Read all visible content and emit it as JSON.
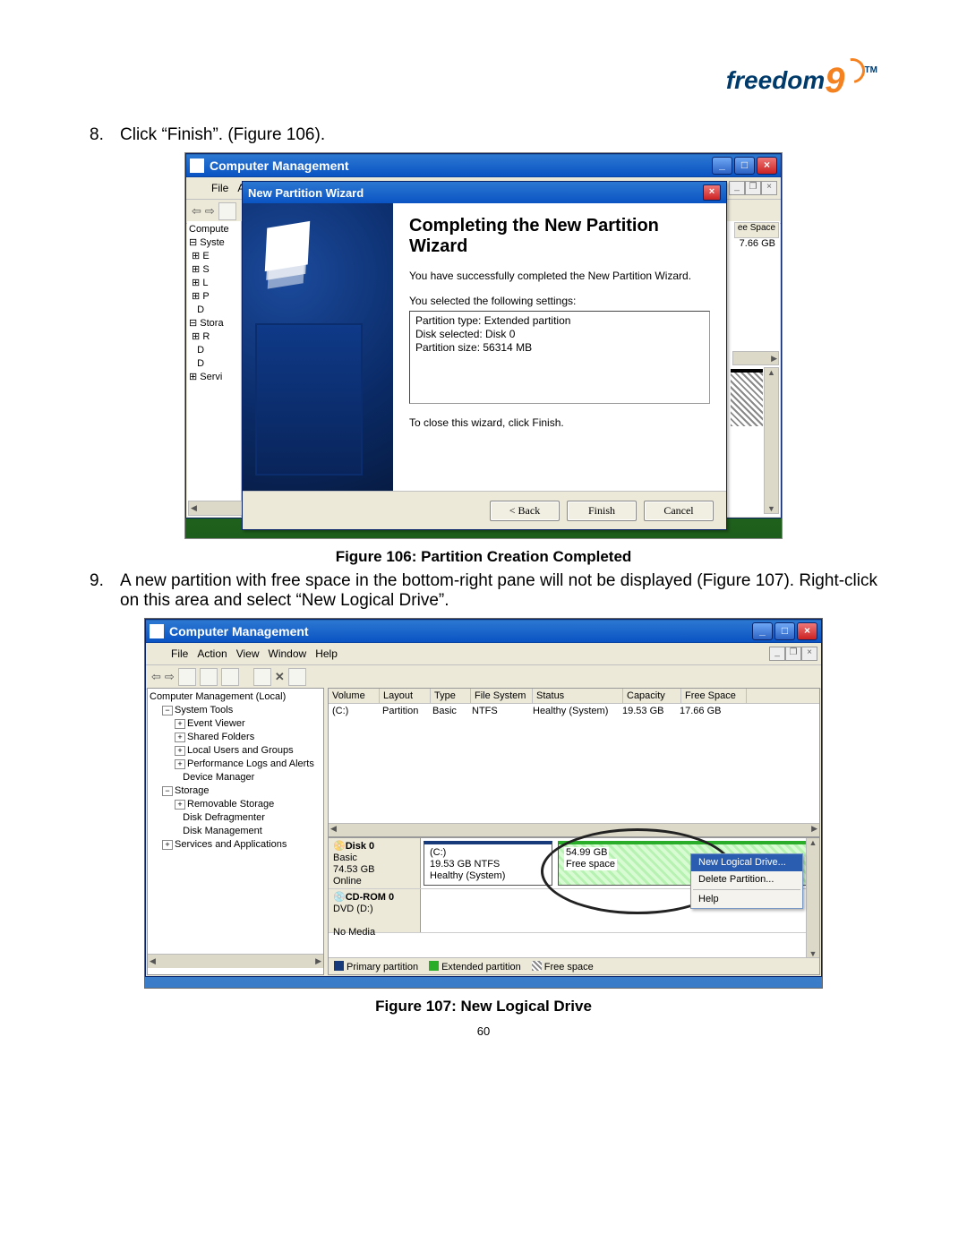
{
  "page_number": "60",
  "logo": "freedom",
  "logo_nine": "9",
  "logo_tm": "TM",
  "step8": {
    "num": "8.",
    "text": "Click “Finish”. (Figure 106)."
  },
  "step9": {
    "num": "9.",
    "text": "A new partition with free space in the bottom-right pane will not be displayed (Figure 107). Right-click on this area and select “New Logical Drive”."
  },
  "fig106_caption": "Figure 106: Partition Creation Completed",
  "fig107_caption": "Figure 107: New Logical Drive",
  "fig106": {
    "window_title": "Computer Management",
    "menu": {
      "file": "File",
      "a": "A"
    },
    "toolbar": {
      "back": "⇦",
      "fwd": "⇨"
    },
    "tree": [
      "Compute",
      "Syste",
      "E",
      "S",
      "L",
      "P",
      "D",
      "Stora",
      "R",
      "D",
      "D",
      "Servi"
    ],
    "list_header": "ee Space",
    "list_value": "7.66 GB",
    "wizard": {
      "title": "New Partition Wizard",
      "heading": "Completing the New Partition Wizard",
      "success": "You have successfully completed the New Partition Wizard.",
      "selected_label": "You selected the following settings:",
      "settings": "Partition type: Extended partition\nDisk selected: Disk 0\nPartition size: 56314 MB",
      "close_msg": "To close this wizard, click Finish.",
      "back": "< Back",
      "finish": "Finish",
      "cancel": "Cancel"
    }
  },
  "fig107": {
    "window_title": "Computer Management",
    "menu": {
      "file": "File",
      "action": "Action",
      "view": "View",
      "window": "Window",
      "help": "Help"
    },
    "tree": {
      "root": "Computer Management (Local)",
      "system_tools": "System Tools",
      "event_viewer": "Event Viewer",
      "shared_folders": "Shared Folders",
      "local_users": "Local Users and Groups",
      "perf": "Performance Logs and Alerts",
      "devmgr": "Device Manager",
      "storage": "Storage",
      "removable": "Removable Storage",
      "defrag": "Disk Defragmenter",
      "diskmgmt": "Disk Management",
      "services": "Services and Applications"
    },
    "volumes": {
      "hdr": {
        "volume": "Volume",
        "layout": "Layout",
        "type": "Type",
        "fs": "File System",
        "status": "Status",
        "cap": "Capacity",
        "free": "Free Space"
      },
      "row": {
        "volume": "(C:)",
        "layout": "Partition",
        "type": "Basic",
        "fs": "NTFS",
        "status": "Healthy (System)",
        "cap": "19.53 GB",
        "free": "17.66 GB"
      }
    },
    "disk0": {
      "title": "Disk 0",
      "basic": "Basic",
      "size": "74.53 GB",
      "state": "Online",
      "c_label": "(C:)",
      "c_size": "19.53 GB NTFS",
      "c_status": "Healthy (System)",
      "free_size": "54.99 GB",
      "free_label": "Free space"
    },
    "cdrom": {
      "title": "CD-ROM 0",
      "dvd": "DVD (D:)",
      "nomedia": "No Media"
    },
    "legend": {
      "primary": "Primary partition",
      "ext": "Extended partition",
      "free": "Free space"
    },
    "context": {
      "new": "New Logical Drive...",
      "del": "Delete Partition...",
      "help": "Help"
    }
  }
}
